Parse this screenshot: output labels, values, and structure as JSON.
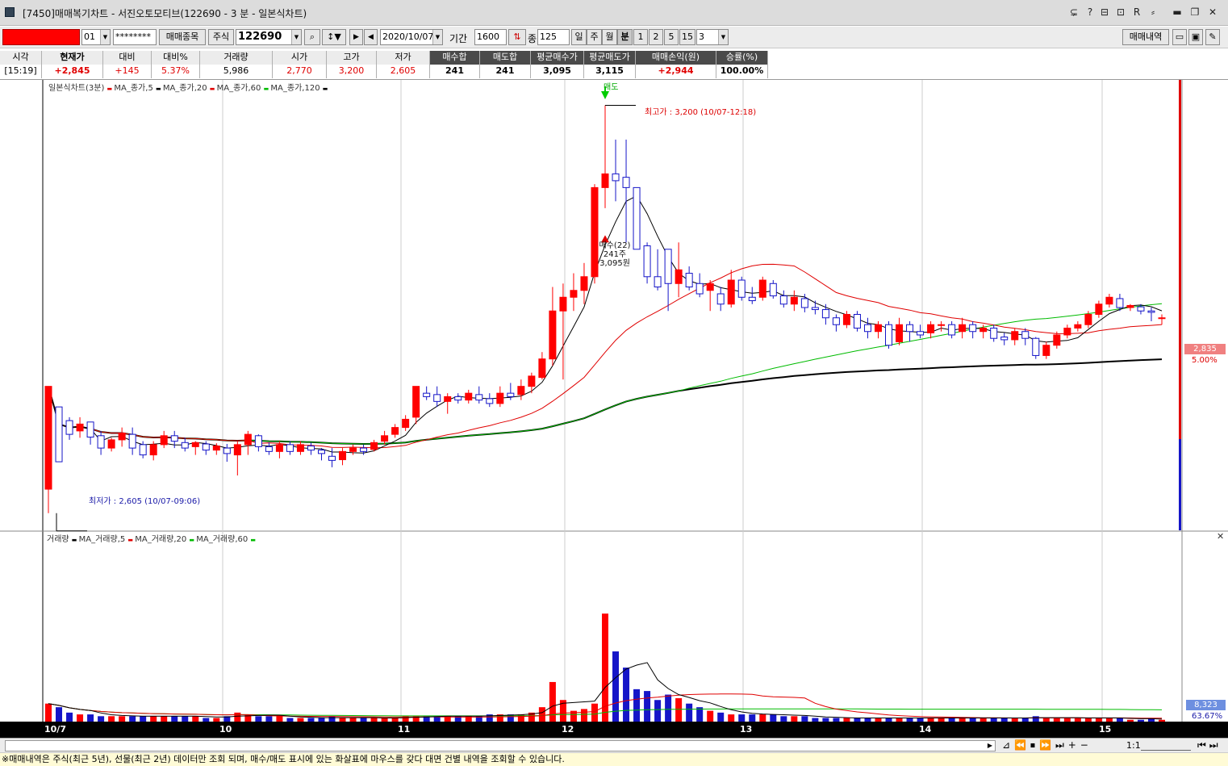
{
  "window": {
    "title": "[7450]매매복기차트 - 서진오토모티브(122690 - 3 분 - 일본식차트)",
    "title_buttons": [
      "⊊",
      "?",
      "⊟",
      "⊡",
      "R",
      "⸗",
      "▬",
      "❐",
      "✕"
    ]
  },
  "toolbar": {
    "account_field": "",
    "account_no": "01",
    "password": "********",
    "trade_item_button": "매매종목",
    "market_button": "주식",
    "code_input": "122690",
    "date_input": "2020/10/07",
    "period_label": "기간",
    "period_input": "1600",
    "count_label": "종",
    "count_input": "125",
    "period_tabs": [
      "일",
      "주",
      "월",
      "분"
    ],
    "minute_tabs": [
      "1",
      "2",
      "5",
      "15"
    ],
    "minute_select": "3",
    "history_button": "매매내역"
  },
  "quote": {
    "headers": [
      "시각",
      "현재가",
      "대비",
      "대비%",
      "거래량",
      "시가",
      "고가",
      "저가",
      "매수합",
      "매도합",
      "평균매수가",
      "평균매도가",
      "매매손익(원)",
      "승률(%)"
    ],
    "values": [
      "[15:19]",
      "+2,845",
      "+145",
      "5.37%",
      "5,986",
      "2,770",
      "3,200",
      "2,605",
      "241",
      "241",
      "3,095",
      "3,115",
      "+2,944",
      "100.00%"
    ],
    "colors": [
      "#000000",
      "#e00000",
      "#e00000",
      "#e00000",
      "#000000",
      "#e00000",
      "#e00000",
      "#e00000",
      "#000000",
      "#000000",
      "#000000",
      "#000000",
      "#e00000",
      "#000000"
    ]
  },
  "price_panel": {
    "legend": [
      "일본식차트(3분)",
      "MA_종가,5",
      "MA_종가,20",
      "MA_종가,60",
      "MA_종가,120"
    ],
    "legend_colors": [
      "#000000",
      "#e00000",
      "#000000",
      "#e00000",
      "#00bb00"
    ],
    "high_label": "최고가 : 3,200 (10/07-12:18)",
    "low_label": "최저가 : 2,605 (10/07-09:06)",
    "sell_label": "매도",
    "buy_label": "매수(22)",
    "buy_qty": "241주",
    "buy_price": "3,095원",
    "right_price": "2,835",
    "right_pct": "5.00%"
  },
  "volume_panel": {
    "legend": [
      "거래량",
      "MA_거래량,5",
      "MA_거래량,20",
      "MA_거래량,60"
    ],
    "legend_colors": [
      "#e00000",
      "#000000",
      "#e00000",
      "#00bb00"
    ],
    "right_value": "8,323",
    "right_pct": "63.67%"
  },
  "x_axis": {
    "labels": [
      "10/7",
      "10",
      "11",
      "12",
      "13",
      "14",
      "15"
    ]
  },
  "statusbar": {
    "text": "※매매내역은 주식(최근 5년), 선물(최근 2년) 데이터만 조회 되며, 매수/매도 표시에 있는 화살표에 마우스를 갖다 대면 건별 내역을 조회할 수 있습니다."
  },
  "chart_data": {
    "type": "candlestick",
    "x_start": "09:00",
    "bar_interval_min": 3,
    "sessions_start_hours": [
      "10",
      "11",
      "12",
      "13",
      "14",
      "15"
    ],
    "ylim": [
      2580,
      3230
    ],
    "candles": [
      [
        2640,
        2790,
        2605,
        2760,
        0.1
      ],
      [
        2760,
        2680,
        2680,
        2740,
        0.08
      ],
      [
        2740,
        2720,
        2712,
        2745,
        0.05
      ],
      [
        2725,
        2735,
        2715,
        2745,
        0.04
      ],
      [
        2738,
        2716,
        2705,
        2738,
        0.04
      ],
      [
        2718,
        2700,
        2690,
        2725,
        0.03
      ],
      [
        2700,
        2712,
        2695,
        2715,
        0.03
      ],
      [
        2712,
        2722,
        2702,
        2730,
        0.03
      ],
      [
        2720,
        2700,
        2690,
        2730,
        0.03
      ],
      [
        2705,
        2690,
        2685,
        2710,
        0.03
      ],
      [
        2690,
        2705,
        2682,
        2710,
        0.03
      ],
      [
        2705,
        2718,
        2700,
        2725,
        0.03
      ],
      [
        2718,
        2710,
        2700,
        2725,
        0.03
      ],
      [
        2708,
        2700,
        2695,
        2715,
        0.03
      ],
      [
        2702,
        2708,
        2690,
        2710,
        0.03
      ],
      [
        2706,
        2697,
        2690,
        2710,
        0.02
      ],
      [
        2697,
        2703,
        2690,
        2707,
        0.02
      ],
      [
        2700,
        2692,
        2680,
        2706,
        0.03
      ],
      [
        2690,
        2705,
        2660,
        2710,
        0.05
      ],
      [
        2705,
        2720,
        2690,
        2725,
        0.04
      ],
      [
        2718,
        2702,
        2695,
        2720,
        0.03
      ],
      [
        2702,
        2695,
        2690,
        2708,
        0.03
      ],
      [
        2695,
        2705,
        2685,
        2710,
        0.03
      ],
      [
        2705,
        2695,
        2690,
        2710,
        0.02
      ],
      [
        2695,
        2705,
        2690,
        2710,
        0.02
      ],
      [
        2703,
        2697,
        2690,
        2708,
        0.02
      ],
      [
        2697,
        2692,
        2682,
        2700,
        0.02
      ],
      [
        2688,
        2682,
        2672,
        2700,
        0.03
      ],
      [
        2683,
        2695,
        2675,
        2700,
        0.02
      ],
      [
        2695,
        2700,
        2690,
        2705,
        0.02
      ],
      [
        2700,
        2695,
        2690,
        2705,
        0.02
      ],
      [
        2698,
        2708,
        2695,
        2712,
        0.02
      ],
      [
        2710,
        2718,
        2705,
        2725,
        0.02
      ],
      [
        2720,
        2730,
        2715,
        2735,
        0.02
      ],
      [
        2730,
        2742,
        2725,
        2748,
        0.03
      ],
      [
        2745,
        2790,
        2735,
        2790,
        0.03
      ],
      [
        2780,
        2775,
        2770,
        2790,
        0.03
      ],
      [
        2778,
        2768,
        2760,
        2790,
        0.03
      ],
      [
        2768,
        2775,
        2750,
        2780,
        0.03
      ],
      [
        2775,
        2770,
        2765,
        2780,
        0.03
      ],
      [
        2770,
        2780,
        2765,
        2785,
        0.03
      ],
      [
        2778,
        2770,
        2765,
        2790,
        0.03
      ],
      [
        2772,
        2765,
        2760,
        2780,
        0.04
      ],
      [
        2765,
        2780,
        2760,
        2790,
        0.04
      ],
      [
        2780,
        2775,
        2770,
        2795,
        0.04
      ],
      [
        2778,
        2790,
        2770,
        2800,
        0.04
      ],
      [
        2790,
        2805,
        2780,
        2810,
        0.05
      ],
      [
        2803,
        2830,
        2800,
        2840,
        0.08
      ],
      [
        2830,
        2900,
        2820,
        2935,
        0.22
      ],
      [
        2900,
        2920,
        2800,
        2940,
        0.12
      ],
      [
        2920,
        2930,
        2900,
        2955,
        0.06
      ],
      [
        2930,
        2950,
        2910,
        2970,
        0.07
      ],
      [
        2950,
        3080,
        2940,
        3085,
        0.1
      ],
      [
        3080,
        3100,
        3050,
        3200,
        0.6
      ],
      [
        3100,
        3090,
        3060,
        3150,
        0.39
      ],
      [
        3095,
        3080,
        3000,
        3150,
        0.3
      ],
      [
        3080,
        2990,
        2990,
        3080,
        0.18
      ],
      [
        2995,
        2950,
        2940,
        3000,
        0.17
      ],
      [
        2950,
        2935,
        2930,
        2990,
        0.12
      ],
      [
        2990,
        2940,
        2900,
        2990,
        0.15
      ],
      [
        2940,
        2960,
        2920,
        3000,
        0.13
      ],
      [
        2955,
        2935,
        2930,
        2965,
        0.1
      ],
      [
        2940,
        2925,
        2920,
        2955,
        0.08
      ],
      [
        2930,
        2940,
        2900,
        2945,
        0.06
      ],
      [
        2925,
        2910,
        2900,
        2935,
        0.05
      ],
      [
        2910,
        2945,
        2905,
        2960,
        0.04
      ],
      [
        2945,
        2920,
        2915,
        2950,
        0.04
      ],
      [
        2920,
        2915,
        2910,
        2935,
        0.04
      ],
      [
        2920,
        2945,
        2915,
        2950,
        0.04
      ],
      [
        2940,
        2922,
        2918,
        2945,
        0.04
      ],
      [
        2922,
        2910,
        2905,
        2930,
        0.03
      ],
      [
        2910,
        2920,
        2900,
        2930,
        0.03
      ],
      [
        2918,
        2905,
        2898,
        2925,
        0.03
      ],
      [
        2905,
        2902,
        2895,
        2915,
        0.02
      ],
      [
        2902,
        2890,
        2880,
        2910,
        0.02
      ],
      [
        2890,
        2880,
        2870,
        2895,
        0.02
      ],
      [
        2880,
        2895,
        2875,
        2900,
        0.02
      ],
      [
        2895,
        2875,
        2870,
        2900,
        0.02
      ],
      [
        2880,
        2870,
        2860,
        2890,
        0.02
      ],
      [
        2870,
        2880,
        2860,
        2885,
        0.02
      ],
      [
        2880,
        2850,
        2845,
        2885,
        0.02
      ],
      [
        2855,
        2880,
        2850,
        2890,
        0.02
      ],
      [
        2880,
        2870,
        2855,
        2885,
        0.02
      ],
      [
        2870,
        2865,
        2860,
        2880,
        0.02
      ],
      [
        2868,
        2880,
        2860,
        2885,
        0.02
      ],
      [
        2880,
        2880,
        2870,
        2885,
        0.02
      ],
      [
        2880,
        2865,
        2860,
        2885,
        0.02
      ],
      [
        2870,
        2880,
        2860,
        2890,
        0.02
      ],
      [
        2880,
        2870,
        2860,
        2885,
        0.02
      ],
      [
        2870,
        2875,
        2860,
        2880,
        0.02
      ],
      [
        2875,
        2860,
        2855,
        2880,
        0.02
      ],
      [
        2862,
        2858,
        2850,
        2868,
        0.02
      ],
      [
        2858,
        2870,
        2850,
        2875,
        0.02
      ],
      [
        2870,
        2860,
        2850,
        2875,
        0.02
      ],
      [
        2860,
        2835,
        2830,
        2862,
        0.03
      ],
      [
        2835,
        2850,
        2830,
        2855,
        0.02
      ],
      [
        2850,
        2865,
        2845,
        2870,
        0.02
      ],
      [
        2865,
        2875,
        2860,
        2880,
        0.02
      ],
      [
        2875,
        2880,
        2870,
        2885,
        0.02
      ],
      [
        2880,
        2895,
        2875,
        2900,
        0.02
      ],
      [
        2895,
        2910,
        2890,
        2915,
        0.02
      ],
      [
        2910,
        2920,
        2905,
        2925,
        0.02
      ],
      [
        2918,
        2905,
        2900,
        2925,
        0.02
      ],
      [
        2905,
        2908,
        2900,
        2910,
        0.01
      ],
      [
        2906,
        2900,
        2895,
        2910,
        0.01
      ],
      [
        2900,
        2898,
        2885,
        2905,
        0.02
      ],
      [
        2890,
        2890,
        2880,
        2895,
        0.01
      ]
    ]
  }
}
